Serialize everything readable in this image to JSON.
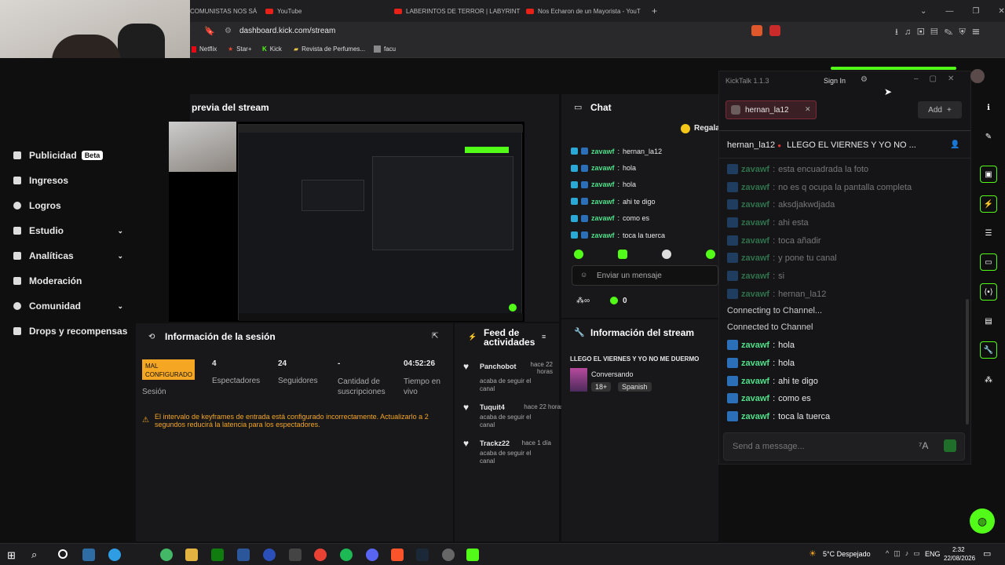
{
  "browser": {
    "tabs": [
      "COMUNISTAS NOS SÁ",
      "YouTube",
      "LABERINTOS DE TERROR | LABYRINT",
      "Nos Echaron de un Mayorista - YouT"
    ],
    "url": "dashboard.kick.com/stream",
    "bookmarks": [
      "Netflix",
      "Star+",
      "Kick",
      "Revista de Perfumes...",
      "facu"
    ]
  },
  "sidebar": {
    "items": [
      {
        "label": "Publicidad",
        "badge": "Beta"
      },
      {
        "label": "Ingresos"
      },
      {
        "label": "Logros"
      },
      {
        "label": "Estudio",
        "chevron": "⌄"
      },
      {
        "label": "Analíticas",
        "chevron": "⌄"
      },
      {
        "label": "Moderación"
      },
      {
        "label": "Comunidad",
        "chevron": "⌄"
      },
      {
        "label": "Drops y recompensas"
      }
    ]
  },
  "preview": {
    "title": "previa del stream"
  },
  "session": {
    "title": "Información de la sesión",
    "status": "MAL CONFIGURADO",
    "status_label": "Sesión",
    "stats": [
      {
        "value": "4",
        "label": "Espectadores"
      },
      {
        "value": "24",
        "label": "Seguidores"
      },
      {
        "value": "-",
        "label": "Cantidad de suscripciones"
      },
      {
        "value": "04:52:26",
        "label": "Tiempo en vivo"
      }
    ],
    "warning": "El intervalo de keyframes de entrada está configurado incorrectamente. Actualizarlo a 2 segundos reducirá la latencia para los espectadores."
  },
  "feed": {
    "title": "Feed de actividades",
    "items": [
      {
        "name": "Panchobot",
        "time": "hace 22 horas",
        "text": "acaba de seguir el canal"
      },
      {
        "name": "Tuquit4",
        "time": "hace 22 horas",
        "text": "acaba de seguir el canal"
      },
      {
        "name": "Trackz22",
        "time": "hace 1 día",
        "text": "acaba de seguir el canal"
      }
    ]
  },
  "chat": {
    "title": "Chat",
    "gift": "Regala",
    "messages": [
      {
        "user": "zavawf",
        "text": "hernan_la12"
      },
      {
        "user": "zavawf",
        "text": "hola"
      },
      {
        "user": "zavawf",
        "text": "hola"
      },
      {
        "user": "zavawf",
        "text": "ahi te digo"
      },
      {
        "user": "zavawf",
        "text": "como es"
      },
      {
        "user": "zavawf",
        "text": "toca la tuerca"
      }
    ],
    "input_placeholder": "Enviar un mensaje",
    "viewer_count": "0"
  },
  "stream_info": {
    "title": "Información del stream",
    "stream_title": "LLEGO EL VIERNES Y YO NO ME DUERMO",
    "category": "Conversando",
    "tags": [
      "18+",
      "Spanish"
    ]
  },
  "kicktalk": {
    "title": "KickTalk 1.1.3",
    "sign_in": "Sign In",
    "channel_tab": "hernan_la12",
    "add_label": "Add",
    "header_user": "hernan_la12",
    "header_title": "LLEGO EL VIERNES Y YO NO ...",
    "old_messages": [
      {
        "user": "zavawf",
        "text": "esta encuadrada la foto"
      },
      {
        "user": "zavawf",
        "text": "no es q ocupa la pantalla completa"
      },
      {
        "user": "zavawf",
        "text": "aksdjakwdjada"
      },
      {
        "user": "zavawf",
        "text": "ahi esta"
      },
      {
        "user": "zavawf",
        "text": "toca añadir"
      },
      {
        "user": "zavawf",
        "text": "y pone tu canal"
      },
      {
        "user": "zavawf",
        "text": "si"
      },
      {
        "user": "zavawf",
        "text": "hernan_la12"
      }
    ],
    "system": [
      "Connecting to Channel...",
      "Connected to Channel"
    ],
    "new_messages": [
      {
        "user": "zavawf",
        "text": "hola"
      },
      {
        "user": "zavawf",
        "text": "hola"
      },
      {
        "user": "zavawf",
        "text": "ahi te digo"
      },
      {
        "user": "zavawf",
        "text": "como es"
      },
      {
        "user": "zavawf",
        "text": "toca la tuerca"
      }
    ],
    "input_placeholder": "Send a message..."
  },
  "taskbar": {
    "weather": "5°C Despejado",
    "lang": "ENG",
    "time": "2:32",
    "date": "22/08/2026"
  },
  "colors": {
    "kick_green": "#53fc18",
    "warning_orange": "#f5a623"
  }
}
